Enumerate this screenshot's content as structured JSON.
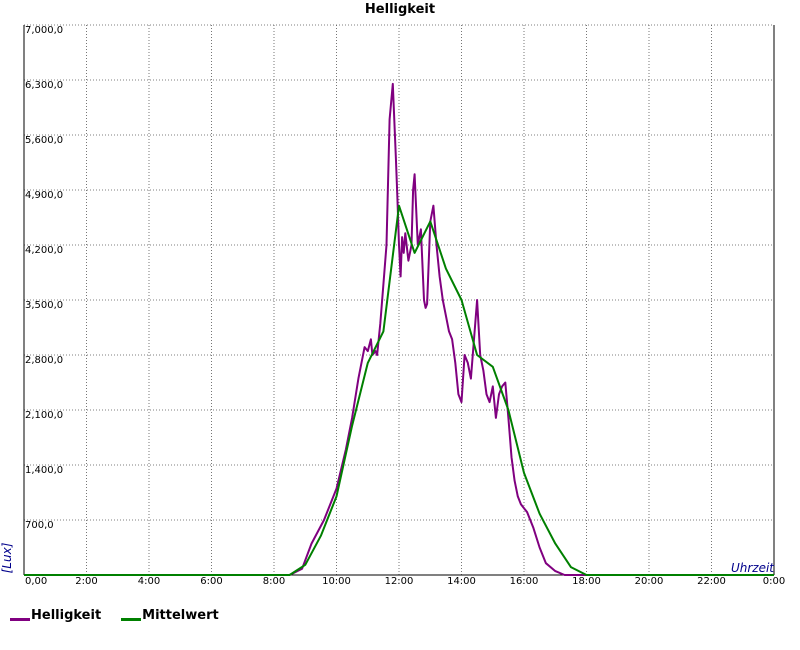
{
  "chart_data": {
    "type": "line",
    "title": "Helligkeit",
    "xlabel": "Uhrzeit",
    "ylabel": "[Lux]",
    "xlim": [
      0,
      24
    ],
    "ylim": [
      0,
      7000
    ],
    "grid": true,
    "legend_position": "bottom-left",
    "x_ticks": [
      "0,00",
      "2:00",
      "4:00",
      "6:00",
      "8:00",
      "10:00",
      "12:00",
      "14:00",
      "16:00",
      "18:00",
      "20:00",
      "22:00",
      "0:00"
    ],
    "y_ticks": [
      "700,0",
      "1,400,0",
      "2,100,0",
      "2,800,0",
      "3,500,0",
      "4,200,0",
      "4,900,0",
      "5,600,0",
      "6,300,0",
      "7,000,0"
    ],
    "series": [
      {
        "name": "Helligkeit",
        "color": "#800080",
        "x": [
          0,
          8.5,
          8.9,
          9.2,
          9.6,
          10.0,
          10.3,
          10.5,
          10.7,
          10.9,
          11.0,
          11.1,
          11.15,
          11.25,
          11.3,
          11.4,
          11.5,
          11.6,
          11.7,
          11.8,
          11.9,
          11.95,
          12.0,
          12.05,
          12.1,
          12.15,
          12.2,
          12.3,
          12.4,
          12.45,
          12.5,
          12.6,
          12.7,
          12.8,
          12.85,
          12.9,
          13.0,
          13.1,
          13.2,
          13.3,
          13.4,
          13.5,
          13.6,
          13.7,
          13.8,
          13.9,
          14.0,
          14.1,
          14.2,
          14.3,
          14.4,
          14.5,
          14.6,
          14.7,
          14.8,
          14.9,
          15.0,
          15.1,
          15.2,
          15.3,
          15.4,
          15.5,
          15.6,
          15.7,
          15.8,
          15.9,
          16.0,
          16.1,
          16.3,
          16.5,
          16.7,
          17.0,
          17.3,
          17.6,
          18.0,
          24
        ],
        "values": [
          0,
          0,
          80,
          400,
          700,
          1100,
          1600,
          2000,
          2500,
          2900,
          2850,
          3000,
          2800,
          2850,
          2800,
          3200,
          3700,
          4200,
          5800,
          6250,
          5300,
          4800,
          4200,
          3800,
          4300,
          4100,
          4350,
          4000,
          4200,
          4900,
          5100,
          4200,
          4400,
          3500,
          3400,
          3450,
          4500,
          4700,
          4200,
          3800,
          3500,
          3300,
          3100,
          3000,
          2700,
          2300,
          2200,
          2800,
          2700,
          2500,
          3000,
          3500,
          2800,
          2600,
          2300,
          2200,
          2400,
          2000,
          2300,
          2400,
          2450,
          2000,
          1500,
          1200,
          1000,
          900,
          850,
          800,
          600,
          350,
          150,
          50,
          0,
          0,
          0,
          0
        ]
      },
      {
        "name": "Mittelwert",
        "color": "#008000",
        "x": [
          0,
          8.5,
          9.0,
          9.5,
          10.0,
          10.5,
          11.0,
          11.5,
          12.0,
          12.5,
          13.0,
          13.5,
          14.0,
          14.5,
          15.0,
          15.5,
          16.0,
          16.5,
          17.0,
          17.5,
          18.0,
          24
        ],
        "values": [
          0,
          0,
          130,
          500,
          1000,
          1900,
          2700,
          3100,
          4700,
          4100,
          4500,
          3900,
          3500,
          2800,
          2650,
          2100,
          1300,
          780,
          400,
          100,
          0,
          0
        ]
      }
    ]
  }
}
